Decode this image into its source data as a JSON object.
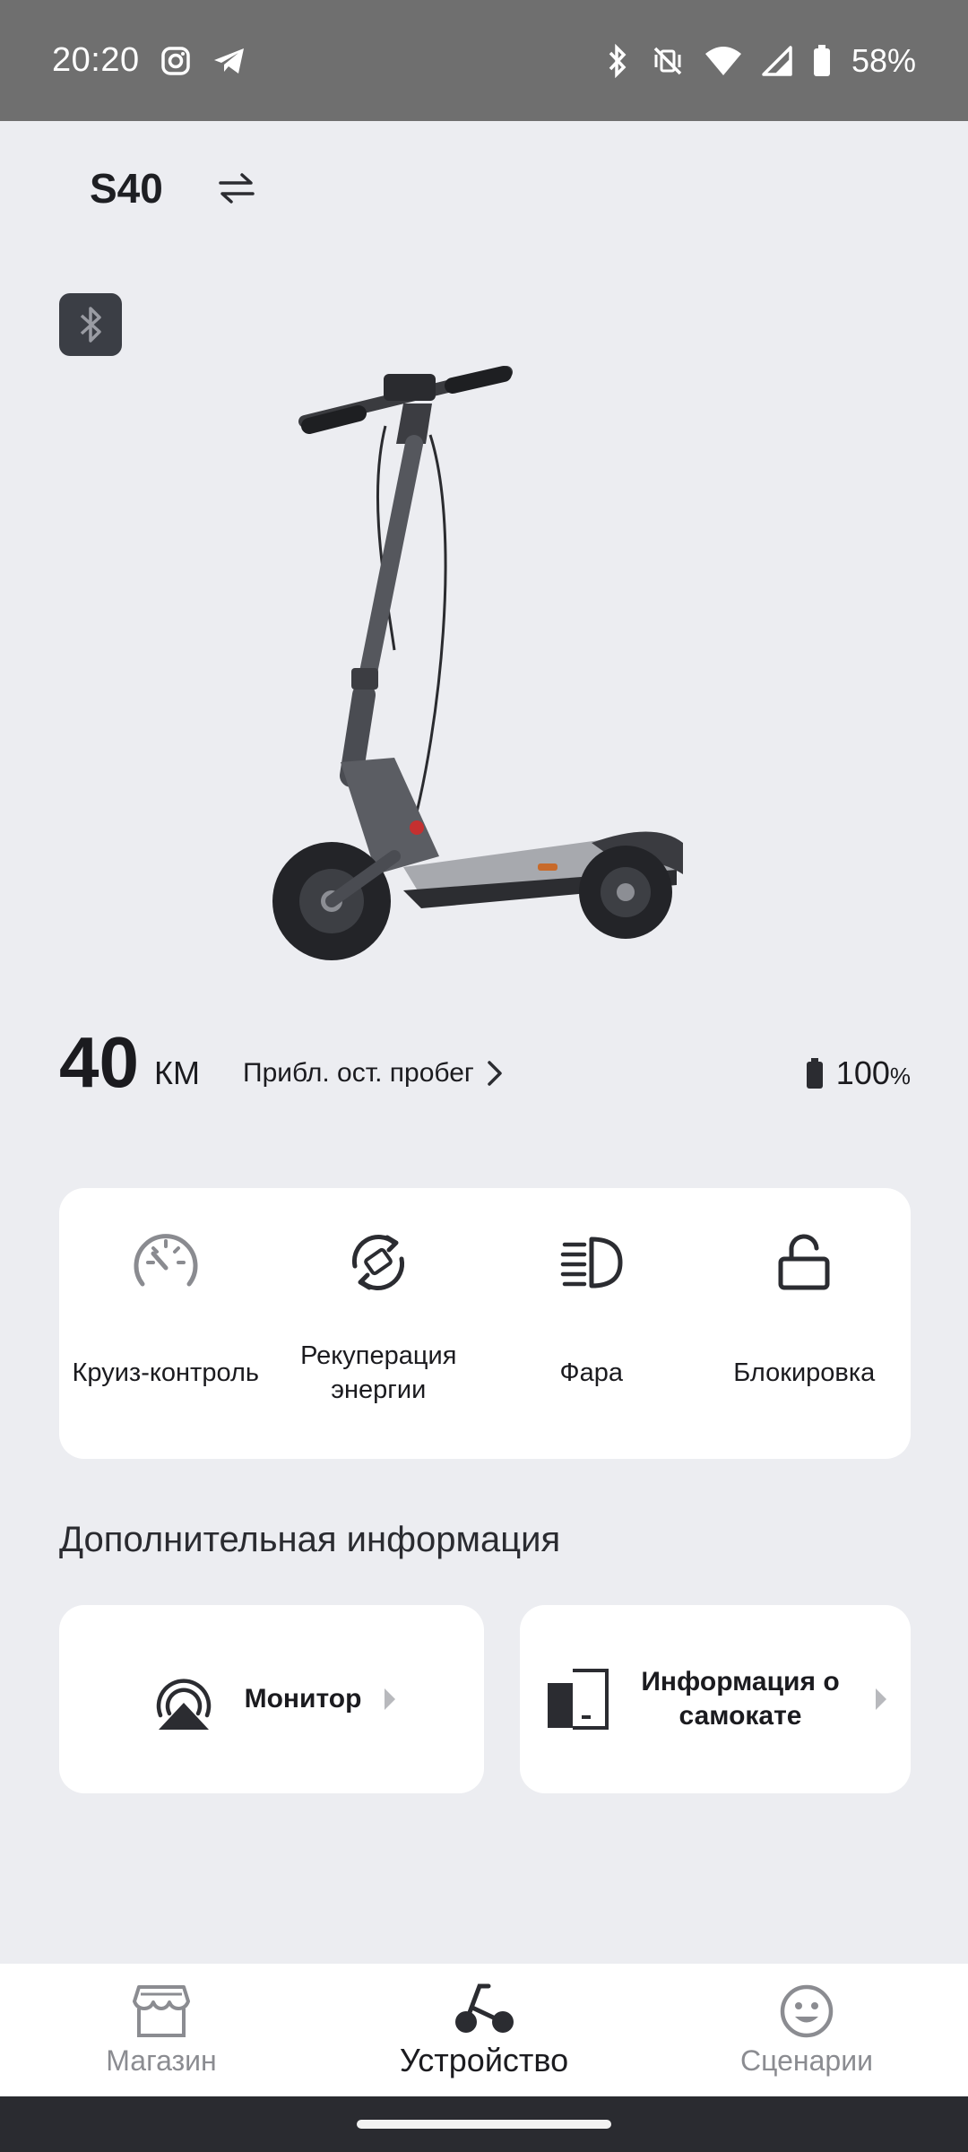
{
  "status_bar": {
    "time": "20:20",
    "battery_percent": "58%",
    "icons_left": [
      "instagram-icon",
      "telegram-icon"
    ],
    "icons_right": [
      "bluetooth-icon",
      "vibrate-off-icon",
      "wifi-icon",
      "signal-icon",
      "battery-icon"
    ]
  },
  "header": {
    "device_name": "S40",
    "switch_icon": "swap-arrows-icon"
  },
  "bluetooth_badge": {
    "icon": "bluetooth-icon"
  },
  "range": {
    "value": "40",
    "unit": "КМ",
    "label": "Прибл. ост. пробег",
    "battery": "100",
    "battery_unit": "%"
  },
  "controls": [
    {
      "label": "Круиз-контроль",
      "icon": "cruise-control-icon"
    },
    {
      "label": "Рекуперация энергии",
      "icon": "energy-recovery-icon"
    },
    {
      "label": "Фара",
      "icon": "headlight-icon"
    },
    {
      "label": "Блокировка",
      "icon": "unlock-icon"
    }
  ],
  "additional": {
    "title": "Дополнительная информация",
    "monitor_label": "Монитор",
    "about_label": "Информация о самокате"
  },
  "bottom_nav": {
    "items": [
      {
        "label": "Магазин",
        "icon": "store-icon"
      },
      {
        "label": "Устройство",
        "icon": "scooter-nav-icon"
      },
      {
        "label": "Сценарии",
        "icon": "smiley-icon"
      }
    ],
    "active": "Устройство"
  },
  "colors": {
    "background": "#ecedf1",
    "status_bar": "#6f6f6f",
    "card": "#ffffff",
    "badge": "#3b3e45",
    "muted_text": "#8b8c91"
  }
}
